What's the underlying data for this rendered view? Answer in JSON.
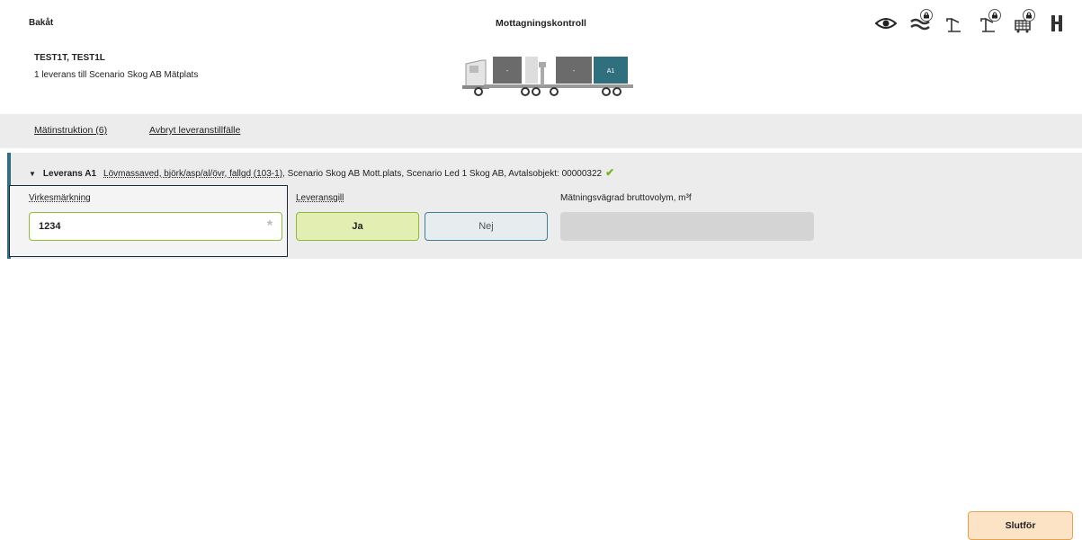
{
  "header": {
    "back_label": "Bakåt",
    "title": "Mottagningskontroll",
    "vehicle_id": "TEST1T, TEST1L",
    "subtitle": "1 leverans till Scenario Skog AB Mätplats"
  },
  "truck": {
    "compartments": [
      "-",
      "-",
      "A1"
    ],
    "active_compartment": "A1",
    "active_color": "#2f6f7e",
    "inactive_color": "#6b6b6b"
  },
  "toolbar": {
    "icons": [
      {
        "name": "eye-icon",
        "locked": false
      },
      {
        "name": "wave-icon",
        "locked": true
      },
      {
        "name": "crane-icon",
        "locked": false
      },
      {
        "name": "crane-locked-icon",
        "locked": true
      },
      {
        "name": "basket-icon",
        "locked": true
      },
      {
        "name": "gate-icon",
        "locked": false
      }
    ]
  },
  "actions": {
    "instruction_label": "Mätinstruktion (6)",
    "cancel_label": "Avbryt leveranstillfälle"
  },
  "delivery": {
    "label": "Leverans A1",
    "product": "Lövmassaved, björk/asp/al/övr, fallgd (103-1)",
    "details": ", Scenario Skog AB Mott.plats, Scenario Led 1 Skog AB, Avtalsobjekt: 00000322",
    "check_icon": "check-icon"
  },
  "form": {
    "marking_label": "Virkesmärkning",
    "marking_value": "1234",
    "required_mark": "*",
    "valid_label": "Leveransgill",
    "yes_label": "Ja",
    "no_label": "Nej",
    "selected": "Ja",
    "volume_label": "Mätningsvägrad bruttovolym, m³f",
    "volume_value": ""
  },
  "footer": {
    "finish_label": "Slutför"
  },
  "colors": {
    "accent": "#2f6f7e",
    "valid_green": "#8bbd37",
    "finish_orange": "#e9a24b"
  }
}
